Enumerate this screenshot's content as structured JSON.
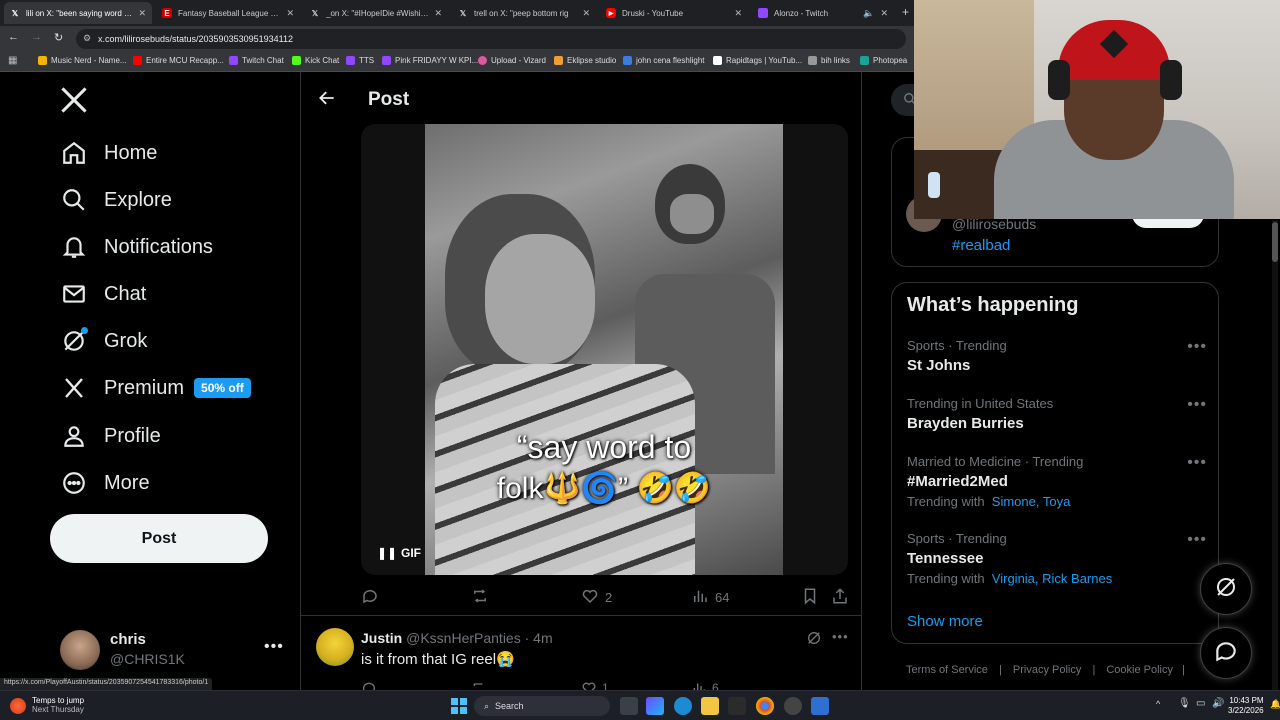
{
  "browser": {
    "tabs": [
      {
        "title": "lili on X: \"been saying word to f",
        "favicon": "x-icon",
        "active": true
      },
      {
        "title": "Fantasy Baseball League Creati",
        "favicon": "espn-icon",
        "active": false
      },
      {
        "title": "_on X: \"#IHopeIDie #WishingTh",
        "favicon": "x-icon",
        "active": false
      },
      {
        "title": "trell on X: \"peep bottom rig",
        "favicon": "x-icon",
        "active": false
      },
      {
        "title": "Druski - YouTube",
        "favicon": "youtube-icon",
        "active": false
      },
      {
        "title": "Alonzo - Twitch",
        "favicon": "twitch-icon",
        "active": false
      }
    ],
    "url": "x.com/lilirosebuds/status/2035903530951934112",
    "bookmarks": [
      "Music Nerd - Name...",
      "Entire MCU Recapp...",
      "Twitch Chat",
      "Kick Chat",
      "TTS",
      "Pink FRIDAYY W KPI...",
      "Upload - Vizard",
      "Eklipse studio",
      "john cena fleshlight",
      "Rapidtags | YouTub...",
      "bih links",
      "Photopea"
    ],
    "status_url": "https://x.com/PlayoffAustin/status/2035907254541783316/photo/1"
  },
  "nav": {
    "items": [
      {
        "label": "Home",
        "icon": "home-icon"
      },
      {
        "label": "Explore",
        "icon": "search-icon"
      },
      {
        "label": "Notifications",
        "icon": "bell-icon"
      },
      {
        "label": "Chat",
        "icon": "mail-icon"
      },
      {
        "label": "Grok",
        "icon": "grok-icon"
      },
      {
        "label": "Premium",
        "icon": "x-logo-icon"
      },
      {
        "label": "Profile",
        "icon": "person-icon"
      },
      {
        "label": "More",
        "icon": "more-circle-icon"
      }
    ],
    "premium_badge": "50% off",
    "post_button": "Post",
    "account": {
      "name": "chris",
      "handle": "@CHRIS1K"
    }
  },
  "post": {
    "header_title": "Post",
    "media": {
      "caption_line1": "“say word to",
      "caption_line2": "folk🔱🌀” 🤣🤣",
      "gif_label": "GIF"
    },
    "actions": {
      "likes": "2",
      "views": "64"
    }
  },
  "reply": {
    "name": "Justin",
    "handle": "@KssnHerPanties",
    "time": "· 4m",
    "text": "is it from that IG reel😭",
    "likes": "1",
    "views": "6"
  },
  "sidebar": {
    "card1": {
      "handle": "@lilirosebuds",
      "hashtag": "#realbad"
    },
    "whats_happening": {
      "title": "What’s happening",
      "trends": [
        {
          "meta": "Sports · Trending",
          "name": "St Johns",
          "with": null
        },
        {
          "meta": "Trending in United States",
          "name": "Brayden Burries",
          "with": null
        },
        {
          "meta": "Married to Medicine · Trending",
          "name": "#Married2Med",
          "with_label": "Trending with",
          "with": "Simone, Toya"
        },
        {
          "meta": "Sports · Trending",
          "name": "Tennessee",
          "with_label": "Trending with",
          "with": "Virginia, Rick Barnes"
        }
      ],
      "show_more": "Show more"
    },
    "footer": [
      "Terms of Service",
      "Privacy Policy",
      "Cookie Policy"
    ]
  },
  "taskbar": {
    "weather_title": "Temps to jump",
    "weather_sub": "Next Thursday",
    "search": "Search",
    "time": "10:43 PM",
    "date": "3/22/2026"
  },
  "colors": {
    "accent": "#1d9bf0",
    "bg": "#000000",
    "muted": "#71767b"
  }
}
